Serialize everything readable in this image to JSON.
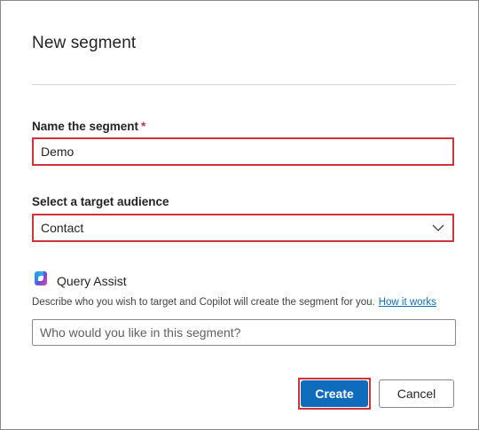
{
  "dialog": {
    "title": "New segment"
  },
  "name_field": {
    "label": "Name the segment",
    "required_mark": "*",
    "value": "Demo"
  },
  "audience_field": {
    "label": "Select a target audience",
    "selected": "Contact"
  },
  "query_assist": {
    "label": "Query Assist",
    "description": "Describe who you wish to target and Copilot will create the segment for you.",
    "link_text": "How it works",
    "placeholder": "Who would you like in this segment?"
  },
  "buttons": {
    "create": "Create",
    "cancel": "Cancel"
  },
  "colors": {
    "accent": "#0f6cbd",
    "highlight": "#d13438"
  },
  "icons": {
    "copilot": "copilot-icon",
    "dropdown": "chevron-down-icon"
  }
}
